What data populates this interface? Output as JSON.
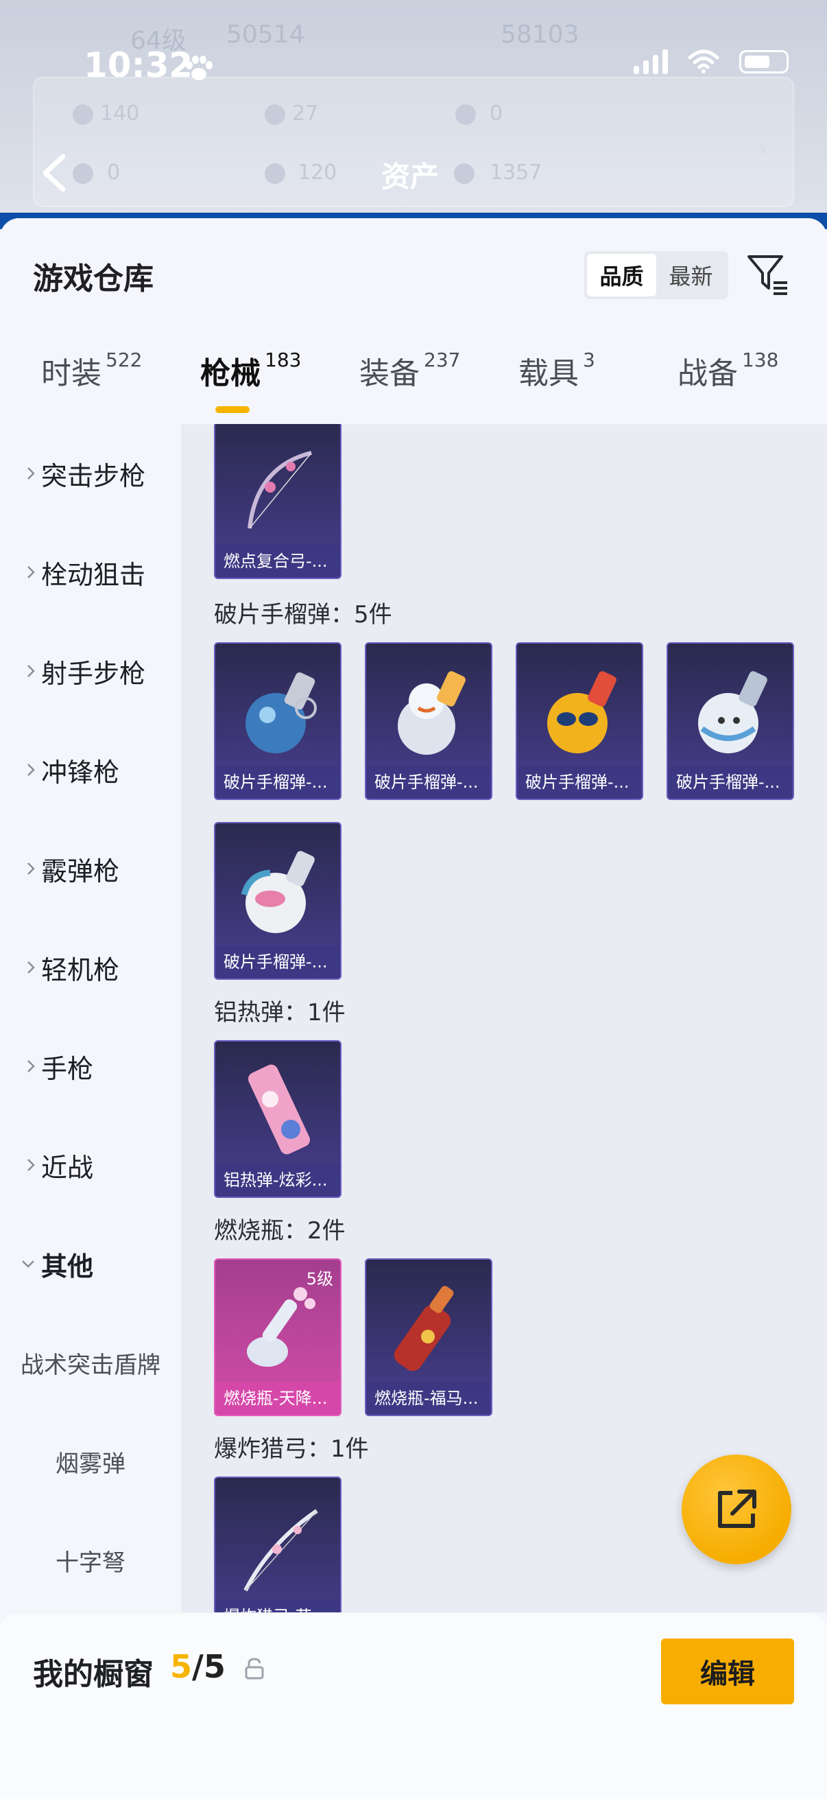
{
  "status_bar": {
    "time": "10:32"
  },
  "background_header": {
    "title": "资产",
    "blur_texts": [
      "64级",
      "50514",
      "58103",
      "140",
      "27",
      "0",
      "0",
      "120",
      "1357"
    ]
  },
  "header": {
    "title": "游戏仓库",
    "sort_options": [
      "品质",
      "最新"
    ],
    "active_sort": "品质"
  },
  "tabs": [
    {
      "label": "时装",
      "count": "522"
    },
    {
      "label": "枪械",
      "count": "183"
    },
    {
      "label": "装备",
      "count": "237"
    },
    {
      "label": "载具",
      "count": "3"
    },
    {
      "label": "战备",
      "count": "138"
    }
  ],
  "sidebar": {
    "categories": [
      "突击步枪",
      "栓动狙击",
      "射手步枪",
      "冲锋枪",
      "霰弹枪",
      "轻机枪",
      "手枪",
      "近战",
      "其他"
    ],
    "subcategories": [
      "战术突击盾牌",
      "烟雾弹",
      "十字弩"
    ]
  },
  "groups": [
    {
      "title": "",
      "items": [
        {
          "name": "燃点复合弓-..."
        }
      ]
    },
    {
      "title": "破片手榴弹：5件",
      "items": [
        {
          "name": "破片手榴弹-..."
        },
        {
          "name": "破片手榴弹-..."
        },
        {
          "name": "破片手榴弹-..."
        },
        {
          "name": "破片手榴弹-..."
        },
        {
          "name": "破片手榴弹-..."
        }
      ]
    },
    {
      "title": "铝热弹：1件",
      "items": [
        {
          "name": "铝热弹-炫彩..."
        }
      ]
    },
    {
      "title": "燃烧瓶：2件",
      "items": [
        {
          "name": "燃烧瓶-天降...",
          "level": "5级"
        },
        {
          "name": "燃烧瓶-福马..."
        }
      ]
    },
    {
      "title": "爆炸猎弓：1件",
      "items": [
        {
          "name": "爆炸猎弓-花..."
        }
      ]
    }
  ],
  "bottom": {
    "label": "我的橱窗",
    "current": "5",
    "separator": "/",
    "total": "5",
    "edit_label": "编辑"
  },
  "colors": {
    "accent": "#f6b400",
    "item_purple": "#3c3675",
    "item_pink": "#c0489e"
  },
  "icons": [
    "back-icon",
    "filter-icon",
    "chevron-right-icon",
    "chevron-down-icon",
    "share-icon",
    "lock-icon"
  ]
}
